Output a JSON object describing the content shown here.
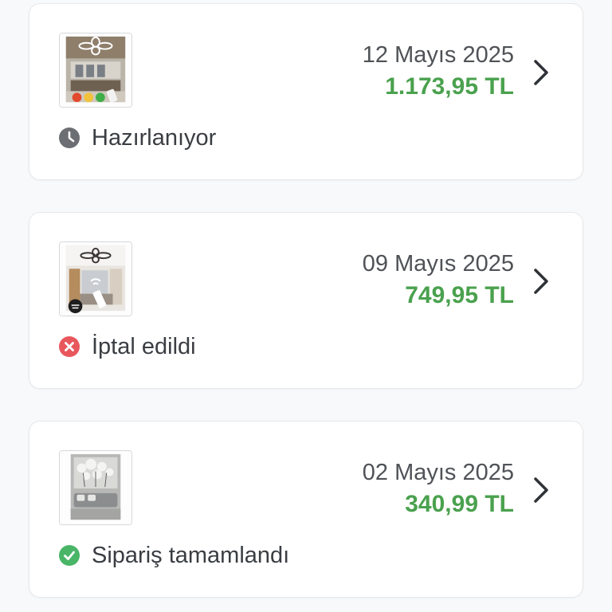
{
  "colors": {
    "price_green": "#4aa14e",
    "pending_gray": "#6b6e73",
    "cancel_red": "#e8575c",
    "done_green": "#49b567",
    "text_dark": "#3a3d42"
  },
  "orders": [
    {
      "date": "12 Mayıs 2025",
      "price": "1.173,95 TL",
      "status": "Hazırlanıyor",
      "status_icon": "clock-icon",
      "thumbnail": "flower-ceiling-lamp-product-image"
    },
    {
      "date": "09 Mayıs 2025",
      "price": "749,95 TL",
      "status": "İptal edildi",
      "status_icon": "cancel-x-icon",
      "thumbnail": "remote-ceiling-lamp-product-image"
    },
    {
      "date": "02 Mayıs 2025",
      "price": "340,99 TL",
      "status": "Sipariş tamamlandı",
      "status_icon": "check-circle-icon",
      "thumbnail": "wall-art-canvas-product-image"
    }
  ]
}
